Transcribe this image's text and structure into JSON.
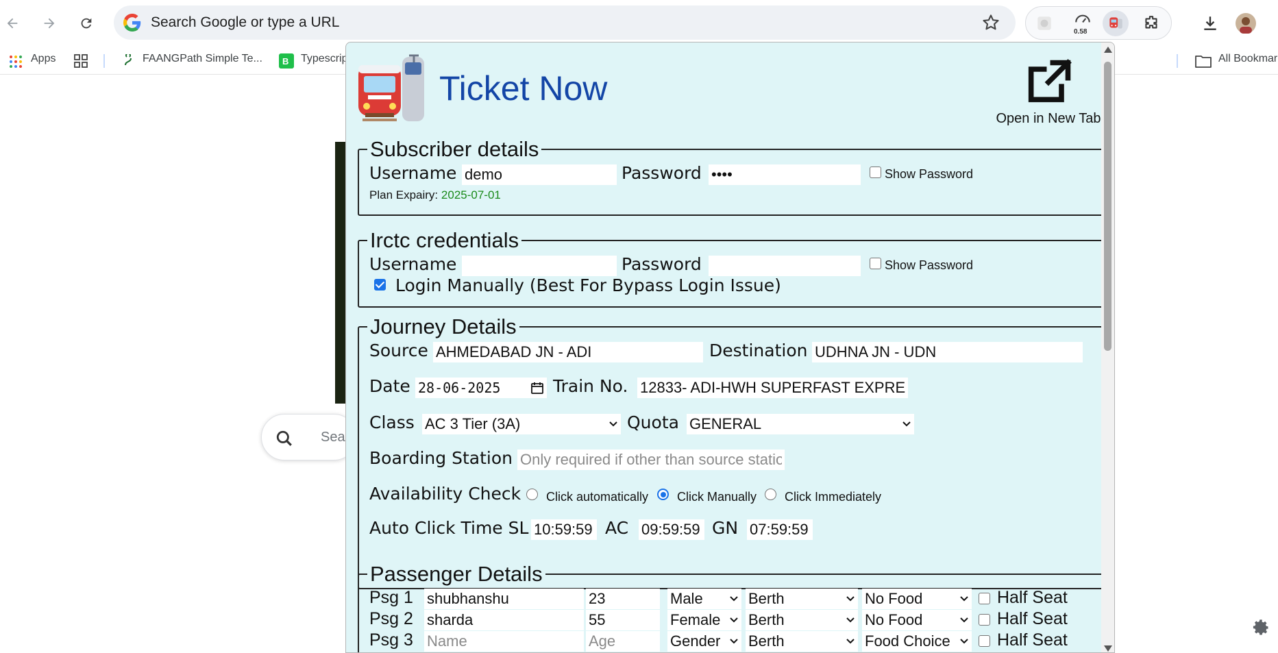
{
  "browser": {
    "omnibox_placeholder": "Search Google or type a URL",
    "extension_badge": "0.58",
    "bookmarks": {
      "apps": "Apps",
      "faangpath": "FAANGPath Simple Te...",
      "typescript": "Typescrip",
      "all_bookmarks": "All Bookmar"
    }
  },
  "background_page": {
    "search_placeholder": "Sea"
  },
  "popup": {
    "title": "Ticket Now",
    "open_new_tab": "Open in New Tab",
    "subscriber": {
      "legend": "Subscriber details",
      "username_label": "Username",
      "username_value": "demo",
      "password_label": "Password",
      "password_value": "••••",
      "show_password": "Show Password",
      "plan_label": "Plan Expairy:",
      "plan_value": "2025-07-01"
    },
    "irctc": {
      "legend": "Irctc credentials",
      "username_label": "Username",
      "username_value": "",
      "password_label": "Password",
      "password_value": "",
      "show_password": "Show Password",
      "login_manually": "Login Manually (Best For Bypass Login Issue)"
    },
    "journey": {
      "legend": "Journey Details",
      "source_label": "Source",
      "source_value": "AHMEDABAD JN - ADI",
      "destination_label": "Destination",
      "destination_value": "UDHNA JN - UDN",
      "date_label": "Date",
      "date_value": "28-06-2025",
      "train_label": "Train No.",
      "train_value": "12833- ADI-HWH SUPERFAST EXPRE",
      "class_label": "Class",
      "class_value": "AC 3 Tier (3A)",
      "quota_label": "Quota",
      "quota_value": "GENERAL",
      "boarding_label": "Boarding Station",
      "boarding_placeholder": "Only required if other than source statio",
      "availability_label": "Availability Check",
      "availability_options": [
        "Click automatically",
        "Click Manually",
        "Click Immediately"
      ],
      "availability_selected": "Click Manually",
      "auto_click_label": "Auto Click Time SL",
      "sl_time": "10:59:59",
      "ac_label": "AC",
      "ac_time": "09:59:59",
      "gn_label": "GN",
      "gn_time": "07:59:59"
    },
    "passengers": {
      "legend": "Passenger Details",
      "half_seat_label": "Half Seat",
      "rows": [
        {
          "label": "Psg 1",
          "name": "shubhanshu",
          "age": "23",
          "gender": "Male",
          "berth": "Berth",
          "food": "No Food"
        },
        {
          "label": "Psg 2",
          "name": "sharda",
          "age": "55",
          "gender": "Female",
          "berth": "Berth",
          "food": "No Food"
        },
        {
          "label": "Psg 3",
          "name": "",
          "name_placeholder": "Name",
          "age": "",
          "age_placeholder": "Age",
          "gender": "Gender",
          "berth": "Berth",
          "food": "Food Choice"
        }
      ]
    }
  }
}
